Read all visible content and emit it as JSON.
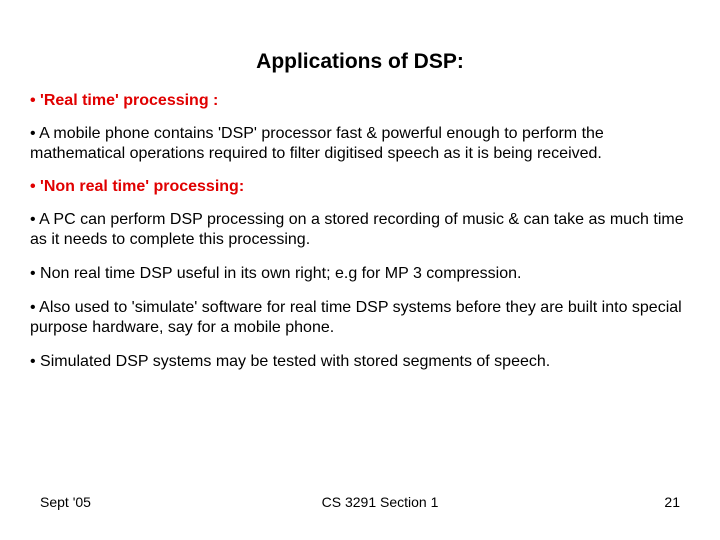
{
  "title": "Applications of DSP:",
  "items": [
    {
      "type": "heading",
      "text": "• 'Real time' processing :"
    },
    {
      "type": "body",
      "text": "• A mobile phone contains 'DSP' processor fast & powerful enough to perform the mathematical operations required to filter digitised speech as it is being received."
    },
    {
      "type": "heading",
      "text": "• 'Non real time' processing:"
    },
    {
      "type": "body",
      "text": "• A  PC can perform DSP processing on a stored recording of music & can take as much time as it needs to complete this processing."
    },
    {
      "type": "body",
      "text": "• Non real time DSP useful in its own right; e.g  for MP 3 compression."
    },
    {
      "type": "body",
      "text": "• Also used to 'simulate' software for real time DSP systems before they are built into special purpose hardware, say for a mobile phone."
    },
    {
      "type": "body",
      "text": "• Simulated DSP systems may be tested with stored segments of speech."
    }
  ],
  "footer": {
    "left": "Sept '05",
    "center": "CS 3291 Section 1",
    "right": "21"
  }
}
